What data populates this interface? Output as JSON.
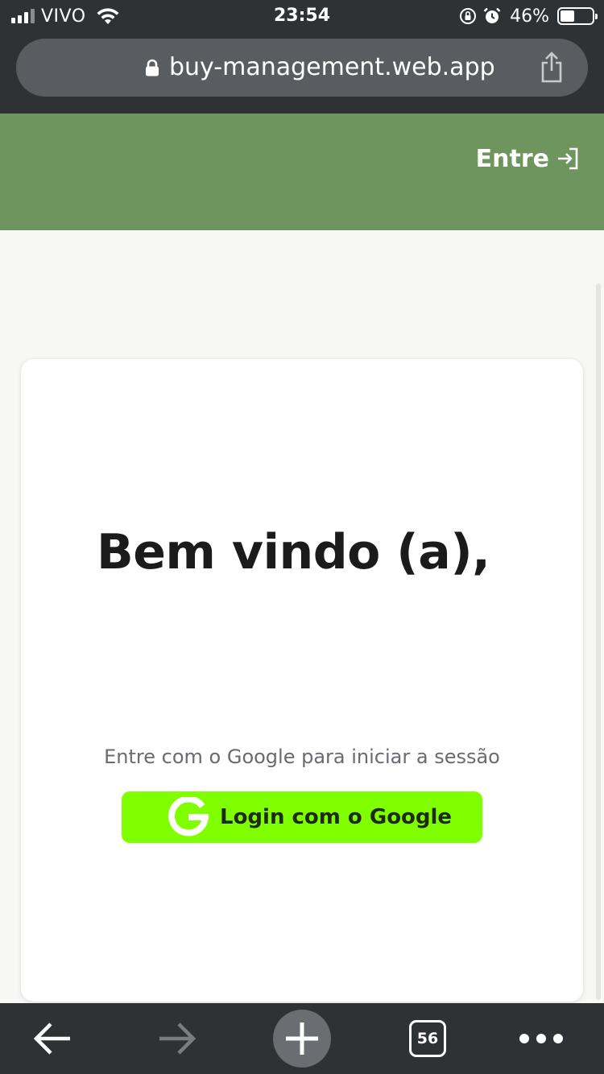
{
  "status_bar": {
    "carrier": "VIVO",
    "time": "23:54",
    "battery_percent": "46%",
    "battery_level": 0.46,
    "icons": [
      "signal-icon",
      "wifi-icon",
      "orientation-lock-icon",
      "alarm-icon",
      "battery-icon"
    ]
  },
  "browser": {
    "url": "buy-management.web.app",
    "icons": [
      "lock-icon",
      "share-icon"
    ]
  },
  "header": {
    "login_label": "Entre",
    "login_icon": "sign-in-icon",
    "background_color": "#6e955d"
  },
  "card": {
    "welcome": "Bem vindo (a),",
    "hint": "Entre com o Google para iniciar a sessão",
    "google_button_label": "Login com o Google",
    "google_button_icon": "google-g-icon",
    "google_button_color": "#80ff00"
  },
  "toolbar": {
    "tab_count": "56",
    "icons": [
      "back-arrow-icon",
      "forward-arrow-icon",
      "plus-icon",
      "tabs-icon",
      "more-dots-icon"
    ]
  }
}
